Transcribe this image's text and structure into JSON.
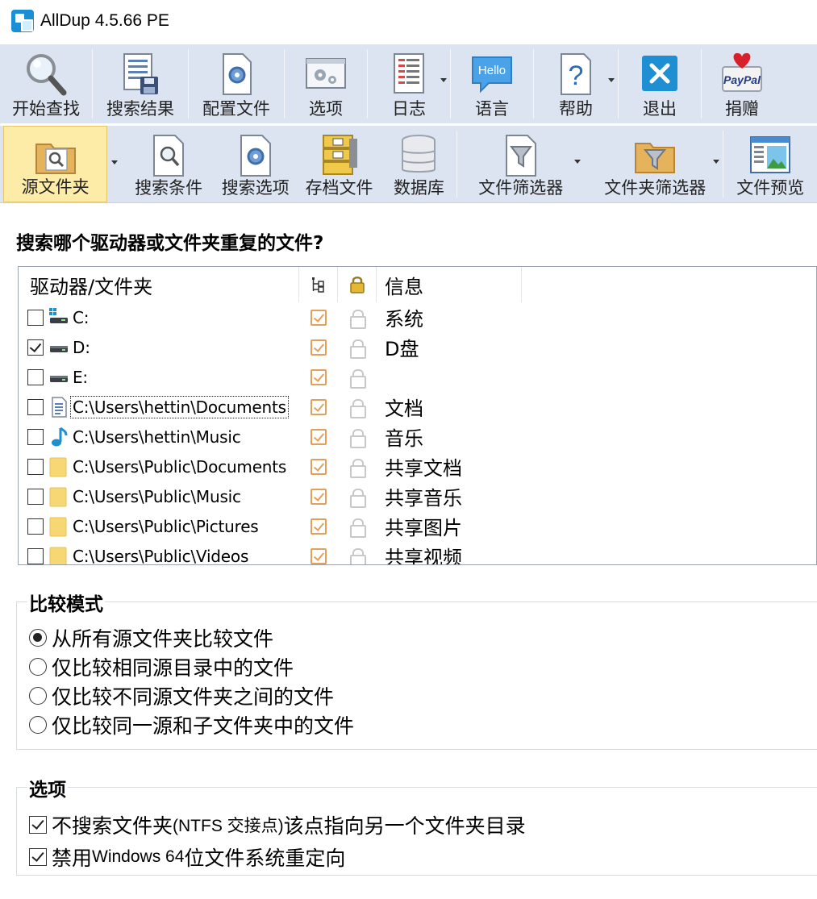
{
  "window": {
    "title": "AllDup 4.5.66 PE"
  },
  "toolbar1": {
    "buttons": [
      {
        "id": "start-search",
        "label": "开始查找"
      },
      {
        "id": "search-results",
        "label": "搜索结果"
      },
      {
        "id": "config-file",
        "label": "配置文件"
      },
      {
        "id": "options",
        "label": "选项"
      },
      {
        "id": "log",
        "label": "日志"
      },
      {
        "id": "language",
        "label": "语言",
        "icon_text": "Hello"
      },
      {
        "id": "help",
        "label": "帮助"
      },
      {
        "id": "exit",
        "label": "退出"
      },
      {
        "id": "donate",
        "label": "捐赠",
        "icon_text": "PayPal"
      }
    ]
  },
  "toolbar2": {
    "buttons": [
      {
        "id": "source-folder",
        "label": "源文件夹",
        "active": true
      },
      {
        "id": "search-criteria",
        "label": "搜索条件"
      },
      {
        "id": "search-options",
        "label": "搜索选项"
      },
      {
        "id": "archive-files",
        "label": "存档文件"
      },
      {
        "id": "database",
        "label": "数据库"
      },
      {
        "id": "file-filter",
        "label": "文件筛选器"
      },
      {
        "id": "folder-filter",
        "label": "文件夹筛选器"
      },
      {
        "id": "file-preview",
        "label": "文件预览"
      }
    ]
  },
  "source": {
    "heading": "搜索哪个驱动器或文件夹重复的文件?",
    "columns": {
      "folder": "驱动器/文件夹",
      "info": "信息"
    },
    "rows": [
      {
        "path": "C:",
        "info": "系统",
        "checked": false,
        "icon": "windows-drive-icon"
      },
      {
        "path": "D:",
        "info": "D盘",
        "checked": true,
        "icon": "drive-icon"
      },
      {
        "path": "E:",
        "info": "",
        "checked": false,
        "icon": "drive-icon"
      },
      {
        "path": "C:\\Users\\hettin\\Documents",
        "info": "文档",
        "checked": false,
        "icon": "document-icon"
      },
      {
        "path": "C:\\Users\\hettin\\Music",
        "info": "音乐",
        "checked": false,
        "icon": "music-note-icon"
      },
      {
        "path": "C:\\Users\\Public\\Documents",
        "info": "共享文档",
        "checked": false,
        "icon": "folder-icon"
      },
      {
        "path": "C:\\Users\\Public\\Music",
        "info": "共享音乐",
        "checked": false,
        "icon": "folder-icon"
      },
      {
        "path": "C:\\Users\\Public\\Pictures",
        "info": "共享图片",
        "checked": false,
        "icon": "folder-icon"
      },
      {
        "path": "C:\\Users\\Public\\Videos",
        "info": "共享视频",
        "checked": false,
        "icon": "folder-icon"
      }
    ]
  },
  "compare_mode": {
    "title": "比较模式",
    "options": [
      {
        "label": "从所有源文件夹比较文件",
        "selected": true
      },
      {
        "label": "仅比较相同源目录中的文件",
        "selected": false
      },
      {
        "label": "仅比较不同源文件夹之间的文件",
        "selected": false
      },
      {
        "label": "仅比较同一源和子文件夹中的文件",
        "selected": false
      }
    ]
  },
  "options": {
    "title": "选项",
    "items": [
      {
        "parts": [
          "不搜索文件夹 ",
          "(NTFS 交接点)",
          " 该点指向另一个文件夹目录"
        ],
        "checked": true
      },
      {
        "parts": [
          "禁用 ",
          "Windows 64",
          " 位文件系统重定向"
        ],
        "checked": true
      }
    ]
  }
}
